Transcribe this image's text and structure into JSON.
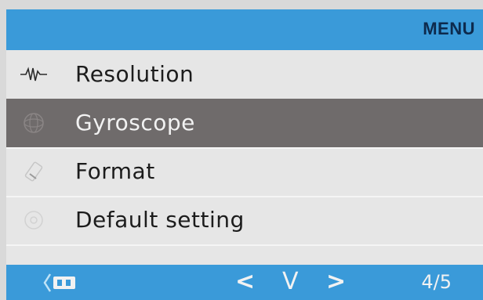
{
  "header": {
    "title": "MENU"
  },
  "menu": {
    "items": [
      {
        "label": "Resolution",
        "icon": "waveform-icon",
        "selected": false
      },
      {
        "label": "Gyroscope",
        "icon": "gyroscope-icon",
        "selected": true
      },
      {
        "label": "Format",
        "icon": "format-icon",
        "selected": false
      },
      {
        "label": "Default setting",
        "icon": "default-setting-icon",
        "selected": false
      }
    ]
  },
  "footer": {
    "back_icon": "back-icon",
    "prev": "<",
    "down": "V",
    "next": ">",
    "page": "4/5"
  },
  "colors": {
    "bar": "#3a9ad9",
    "background": "#e6e6e6",
    "selected": "#6f6b6b",
    "title": "#0d2a4d"
  }
}
